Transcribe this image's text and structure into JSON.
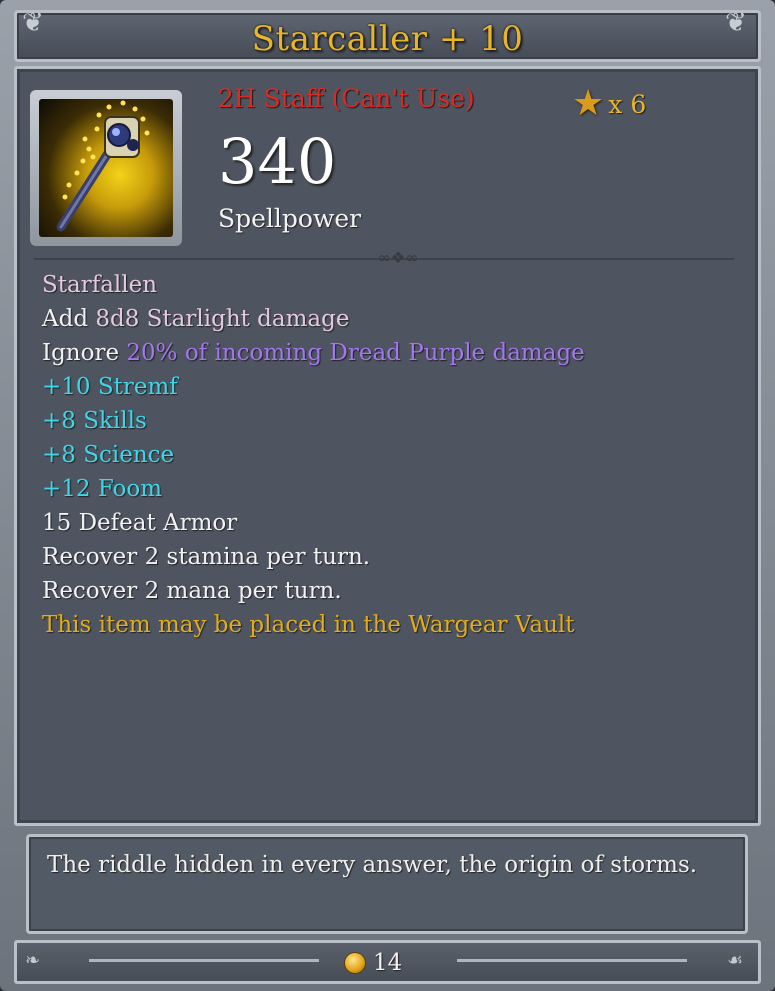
{
  "item": {
    "name": "Starcaller + 10",
    "type_label": "2H Staff (Can't Use)",
    "star_rating": 6,
    "star_count_label": "x 6",
    "power_value": "340",
    "power_label": "Spellpower"
  },
  "properties": [
    {
      "text": "Starfallen",
      "color": "#e6c9df"
    },
    {
      "prefix": "Add ",
      "text": "8d8 Starlight damage",
      "prefix_color": "#f1f1f1",
      "color": "#e6c9df"
    },
    {
      "prefix": "Ignore ",
      "text": "20% of incoming Dread Purple damage",
      "prefix_color": "#f1f1f1",
      "color": "#a577ee"
    },
    {
      "text": "+10 Stremf",
      "color": "#3fd7e8"
    },
    {
      "text": "+8 Skills",
      "color": "#3fd7e8"
    },
    {
      "text": "+8 Science",
      "color": "#3fd7e8"
    },
    {
      "text": "+12 Foom",
      "color": "#3fd7e8"
    },
    {
      "text": "15 Defeat Armor",
      "color": "#f1f1f1"
    },
    {
      "text": "Recover 2 stamina per turn.",
      "color": "#f1f1f1"
    },
    {
      "text": "Recover 2 mana per turn.",
      "color": "#f1f1f1"
    },
    {
      "text": "This item may be placed in the Wargear Vault",
      "color": "#e3ad19"
    }
  ],
  "lore": "The riddle hidden in every answer, the origin of storms.",
  "gold": "14",
  "icons": {
    "item_image": "staff-icon",
    "rating": "star-icon",
    "currency": "coin-icon"
  },
  "colors": {
    "title": "#e8b52a",
    "unusable": "#d92b26",
    "magic": "#3fd7e8",
    "purple": "#a577ee",
    "vault": "#e3ad19"
  }
}
